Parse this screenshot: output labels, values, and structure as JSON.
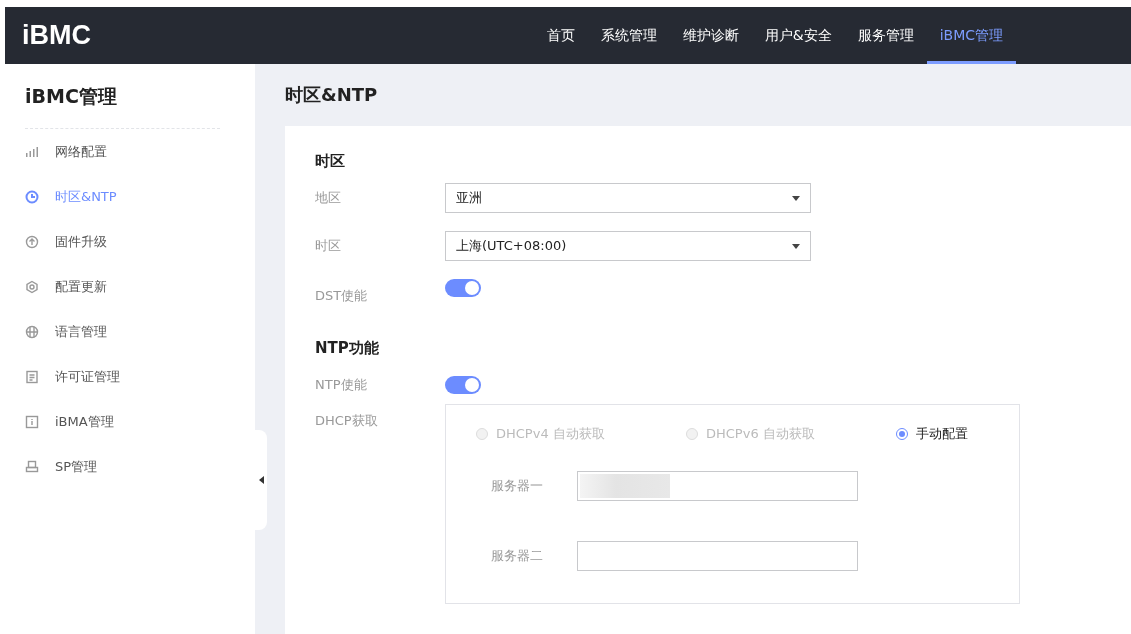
{
  "header": {
    "logo": "iBMC",
    "nav": [
      {
        "label": "首页",
        "selected": false
      },
      {
        "label": "系统管理",
        "selected": false
      },
      {
        "label": "维护诊断",
        "selected": false
      },
      {
        "label": "用户&安全",
        "selected": false
      },
      {
        "label": "服务管理",
        "selected": false
      },
      {
        "label": "iBMC管理",
        "selected": true
      }
    ]
  },
  "sidebar": {
    "title": "iBMC管理",
    "items": [
      {
        "label": "网络配置",
        "selected": false
      },
      {
        "label": "时区&NTP",
        "selected": true
      },
      {
        "label": "固件升级",
        "selected": false
      },
      {
        "label": "配置更新",
        "selected": false
      },
      {
        "label": "语言管理",
        "selected": false
      },
      {
        "label": "许可证管理",
        "selected": false
      },
      {
        "label": "iBMA管理",
        "selected": false
      },
      {
        "label": "SP管理",
        "selected": false
      }
    ]
  },
  "page_title": "时区&NTP",
  "timezone": {
    "heading": "时区",
    "region": {
      "label": "地区",
      "value": "亚洲"
    },
    "zone": {
      "label": "时区",
      "value": "上海(UTC+08:00)"
    },
    "dst": {
      "label": "DST使能",
      "on": true
    }
  },
  "ntp": {
    "heading": "NTP功能",
    "enable": {
      "label": "NTP使能",
      "on": true
    },
    "dhcp_label": "DHCP获取",
    "modes": [
      {
        "label": "DHCPv4 自动获取",
        "selected": false,
        "disabled": true
      },
      {
        "label": "DHCPv6 自动获取",
        "selected": false,
        "disabled": true
      },
      {
        "label": "手动配置",
        "selected": true,
        "disabled": false
      }
    ],
    "servers": [
      {
        "label": "服务器一",
        "redacted": true
      },
      {
        "label": "服务器二",
        "redacted": false
      }
    ]
  }
}
